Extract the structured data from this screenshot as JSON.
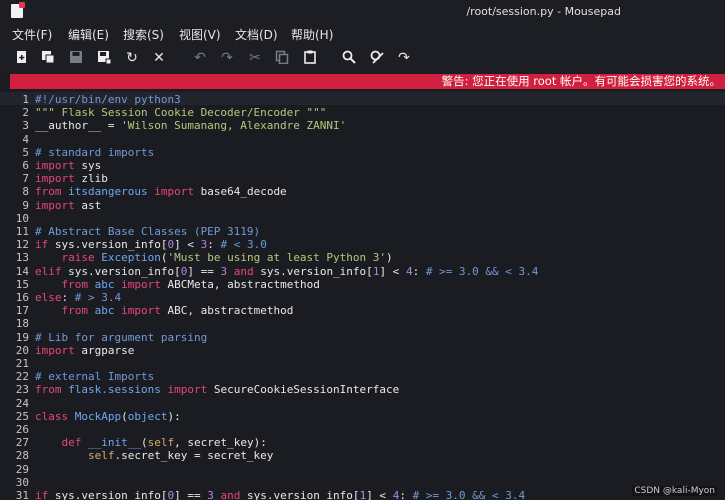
{
  "window": {
    "title": "/root/session.py - Mousepad"
  },
  "menu": [
    "文件(F)",
    "编辑(E)",
    "搜索(S)",
    "视图(V)",
    "文档(D)",
    "帮助(H)"
  ],
  "toolbar": {
    "icons": [
      "new-document-icon",
      "new-window-icon",
      "save-icon",
      "save-as-icon",
      "reload-icon",
      "close-icon",
      "undo-icon",
      "redo-icon",
      "cut-icon",
      "copy-icon",
      "paste-icon",
      "search-icon",
      "replace-icon",
      "goto-line-icon"
    ]
  },
  "warning": {
    "text": "警告: 您正在使用 root 帐户。有可能会损害您的系统。"
  },
  "editor": {
    "lines": [
      {
        "n": "1",
        "parts": [
          {
            "t": "#!/usr/bin/env python3",
            "c": "cm"
          }
        ]
      },
      {
        "n": "2",
        "parts": [
          {
            "t": "\"\"\" Flask Session Cookie Decoder/Encoder \"\"\"",
            "c": "st"
          }
        ]
      },
      {
        "n": "3",
        "parts": [
          {
            "t": "__author__ = ",
            "c": ""
          },
          {
            "t": "'Wilson Sumanang, Alexandre ZANNI'",
            "c": "st"
          }
        ]
      },
      {
        "n": "4",
        "parts": []
      },
      {
        "n": "5",
        "parts": [
          {
            "t": "# standard imports",
            "c": "cm"
          }
        ]
      },
      {
        "n": "6",
        "parts": [
          {
            "t": "import",
            "c": "kw"
          },
          {
            "t": " sys",
            "c": ""
          }
        ]
      },
      {
        "n": "7",
        "parts": [
          {
            "t": "import",
            "c": "kw"
          },
          {
            "t": " zlib",
            "c": ""
          }
        ]
      },
      {
        "n": "8",
        "parts": [
          {
            "t": "from",
            "c": "kw"
          },
          {
            "t": " itsdangerous ",
            "c": "fn"
          },
          {
            "t": "import",
            "c": "kw"
          },
          {
            "t": " base64_decode",
            "c": ""
          }
        ]
      },
      {
        "n": "9",
        "parts": [
          {
            "t": "import",
            "c": "kw"
          },
          {
            "t": " ast",
            "c": ""
          }
        ]
      },
      {
        "n": "10",
        "parts": []
      },
      {
        "n": "11",
        "parts": [
          {
            "t": "# Abstract Base Classes (PEP 3119)",
            "c": "cm"
          }
        ]
      },
      {
        "n": "12",
        "parts": [
          {
            "t": "if",
            "c": "kw"
          },
          {
            "t": " sys.version_info[",
            "c": ""
          },
          {
            "t": "0",
            "c": "nm"
          },
          {
            "t": "] < ",
            "c": ""
          },
          {
            "t": "3",
            "c": "nm"
          },
          {
            "t": ": ",
            "c": ""
          },
          {
            "t": "# < 3.0",
            "c": "cm"
          }
        ]
      },
      {
        "n": "13",
        "parts": [
          {
            "t": "    ",
            "c": ""
          },
          {
            "t": "raise",
            "c": "kw"
          },
          {
            "t": " Exception",
            "c": "fn"
          },
          {
            "t": "(",
            "c": ""
          },
          {
            "t": "'Must be using at least Python 3'",
            "c": "st"
          },
          {
            "t": ")",
            "c": ""
          }
        ]
      },
      {
        "n": "14",
        "parts": [
          {
            "t": "elif",
            "c": "kw"
          },
          {
            "t": " sys.version_info[",
            "c": ""
          },
          {
            "t": "0",
            "c": "nm"
          },
          {
            "t": "] == ",
            "c": ""
          },
          {
            "t": "3",
            "c": "nm"
          },
          {
            "t": " ",
            "c": ""
          },
          {
            "t": "and",
            "c": "kw"
          },
          {
            "t": " sys.version_info[",
            "c": ""
          },
          {
            "t": "1",
            "c": "nm"
          },
          {
            "t": "] < ",
            "c": ""
          },
          {
            "t": "4",
            "c": "nm"
          },
          {
            "t": ": ",
            "c": ""
          },
          {
            "t": "# >= 3.0 && < 3.4",
            "c": "cm"
          }
        ]
      },
      {
        "n": "15",
        "parts": [
          {
            "t": "    ",
            "c": ""
          },
          {
            "t": "from",
            "c": "kw"
          },
          {
            "t": " abc ",
            "c": "fn"
          },
          {
            "t": "import",
            "c": "kw"
          },
          {
            "t": " ABCMeta, abstractmethod",
            "c": ""
          }
        ]
      },
      {
        "n": "16",
        "parts": [
          {
            "t": "else",
            "c": "kw"
          },
          {
            "t": ": ",
            "c": ""
          },
          {
            "t": "# > 3.4",
            "c": "cm"
          }
        ]
      },
      {
        "n": "17",
        "parts": [
          {
            "t": "    ",
            "c": ""
          },
          {
            "t": "from",
            "c": "kw"
          },
          {
            "t": " abc ",
            "c": "fn"
          },
          {
            "t": "import",
            "c": "kw"
          },
          {
            "t": " ABC, abstractmethod",
            "c": ""
          }
        ]
      },
      {
        "n": "18",
        "parts": []
      },
      {
        "n": "19",
        "parts": [
          {
            "t": "# Lib for argument parsing",
            "c": "cm"
          }
        ]
      },
      {
        "n": "20",
        "parts": [
          {
            "t": "import",
            "c": "kw"
          },
          {
            "t": " argparse",
            "c": ""
          }
        ]
      },
      {
        "n": "21",
        "parts": []
      },
      {
        "n": "22",
        "parts": [
          {
            "t": "# external Imports",
            "c": "cm"
          }
        ]
      },
      {
        "n": "23",
        "parts": [
          {
            "t": "from",
            "c": "kw"
          },
          {
            "t": " flask.sessions ",
            "c": "fn"
          },
          {
            "t": "import",
            "c": "kw"
          },
          {
            "t": " SecureCookieSessionInterface",
            "c": ""
          }
        ]
      },
      {
        "n": "24",
        "parts": []
      },
      {
        "n": "25",
        "parts": [
          {
            "t": "class",
            "c": "kw"
          },
          {
            "t": " MockApp",
            "c": "fn"
          },
          {
            "t": "(",
            "c": ""
          },
          {
            "t": "object",
            "c": "fn"
          },
          {
            "t": "):",
            "c": ""
          }
        ]
      },
      {
        "n": "26",
        "parts": []
      },
      {
        "n": "27",
        "parts": [
          {
            "t": "    ",
            "c": ""
          },
          {
            "t": "def",
            "c": "kw"
          },
          {
            "t": " __init__",
            "c": "fn"
          },
          {
            "t": "(",
            "c": ""
          },
          {
            "t": "self",
            "c": "sl"
          },
          {
            "t": ", secret_key):",
            "c": ""
          }
        ]
      },
      {
        "n": "28",
        "parts": [
          {
            "t": "        ",
            "c": ""
          },
          {
            "t": "self",
            "c": "sl"
          },
          {
            "t": ".secret_key = secret_key",
            "c": ""
          }
        ]
      },
      {
        "n": "29",
        "parts": []
      },
      {
        "n": "30",
        "parts": []
      },
      {
        "n": "31",
        "parts": [
          {
            "t": "if",
            "c": "kw"
          },
          {
            "t": " sys.version_info[",
            "c": ""
          },
          {
            "t": "0",
            "c": "nm"
          },
          {
            "t": "] == ",
            "c": ""
          },
          {
            "t": "3",
            "c": "nm"
          },
          {
            "t": " ",
            "c": ""
          },
          {
            "t": "and",
            "c": "kw"
          },
          {
            "t": " sys.version_info[",
            "c": ""
          },
          {
            "t": "1",
            "c": "nm"
          },
          {
            "t": "] < ",
            "c": ""
          },
          {
            "t": "4",
            "c": "nm"
          },
          {
            "t": ": ",
            "c": ""
          },
          {
            "t": "# >= 3.0 && < 3.4",
            "c": "cm"
          }
        ]
      }
    ]
  },
  "watermark": "CSDN @kali-Myon"
}
